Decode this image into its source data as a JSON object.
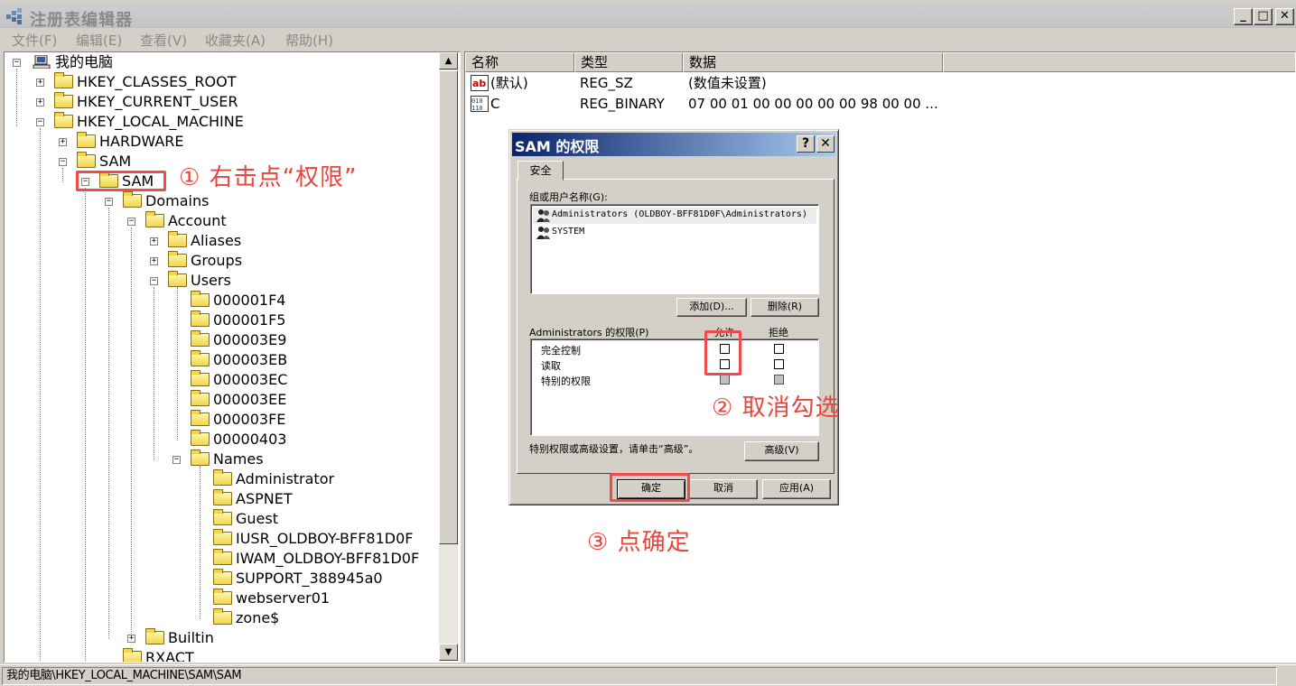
{
  "window": {
    "title": "注册表编辑器",
    "buttons": {
      "minimize": "_",
      "maximize": "□",
      "close": "✕"
    }
  },
  "menu": [
    "文件(F)",
    "编辑(E)",
    "查看(V)",
    "收藏夹(A)",
    "帮助(H)"
  ],
  "tree": {
    "root": "我的电脑",
    "hkcr": "HKEY_CLASSES_ROOT",
    "hkcu": "HKEY_CURRENT_USER",
    "hklm": "HKEY_LOCAL_MACHINE",
    "hardware": "HARDWARE",
    "sam": "SAM",
    "sam_sam": "SAM",
    "domains": "Domains",
    "account": "Account",
    "aliases": "Aliases",
    "groups": "Groups",
    "users": "Users",
    "user_keys": [
      "000001F4",
      "000001F5",
      "000003E9",
      "000003EB",
      "000003EC",
      "000003EE",
      "000003FE",
      "00000403"
    ],
    "names": "Names",
    "name_keys": [
      "Administrator",
      "ASPNET",
      "Guest",
      "IUSR_OLDBOY-BFF81D0F",
      "IWAM_OLDBOY-BFF81D0F",
      "SUPPORT_388945a0",
      "webserver01",
      "zone$"
    ],
    "builtin": "Builtin",
    "rxact": "RXACT"
  },
  "list": {
    "columns": [
      "名称",
      "类型",
      "数据"
    ],
    "rows": [
      {
        "name": "(默认)",
        "type": "REG_SZ",
        "data": "(数值未设置)",
        "icon": "string-value-icon"
      },
      {
        "name": "C",
        "type": "REG_BINARY",
        "data": "07 00 01 00 00 00 00 00 98 00 00 ...",
        "icon": "binary-value-icon"
      }
    ]
  },
  "dialog": {
    "title": "SAM 的权限",
    "help": "?",
    "close": "✕",
    "tab": "安全",
    "group_label": "组或用户名称(G):",
    "users": [
      "Administrators (OLDBOY-BFF81D0F\\Administrators)",
      "SYSTEM"
    ],
    "add_button": "添加(D)...",
    "remove_button": "删除(R)",
    "perm_label": "Administrators 的权限(P)",
    "allow_header": "允许",
    "deny_header": "拒绝",
    "permissions": [
      "完全控制",
      "读取",
      "特别的权限"
    ],
    "advanced_note": "特别权限或高级设置，请单击“高级”。",
    "advanced_button": "高级(V)",
    "ok_button": "确定",
    "cancel_button": "取消",
    "apply_button": "应用(A)"
  },
  "annotations": {
    "step1": "① 右击点“权限”",
    "step2": "② 取消勾选",
    "step3": "③ 点确定",
    "color": "#e8453c"
  },
  "scrollbar": {
    "up": "▲",
    "down": "▼"
  },
  "status": "我的电脑\\HKEY_LOCAL_MACHINE\\SAM\\SAM"
}
